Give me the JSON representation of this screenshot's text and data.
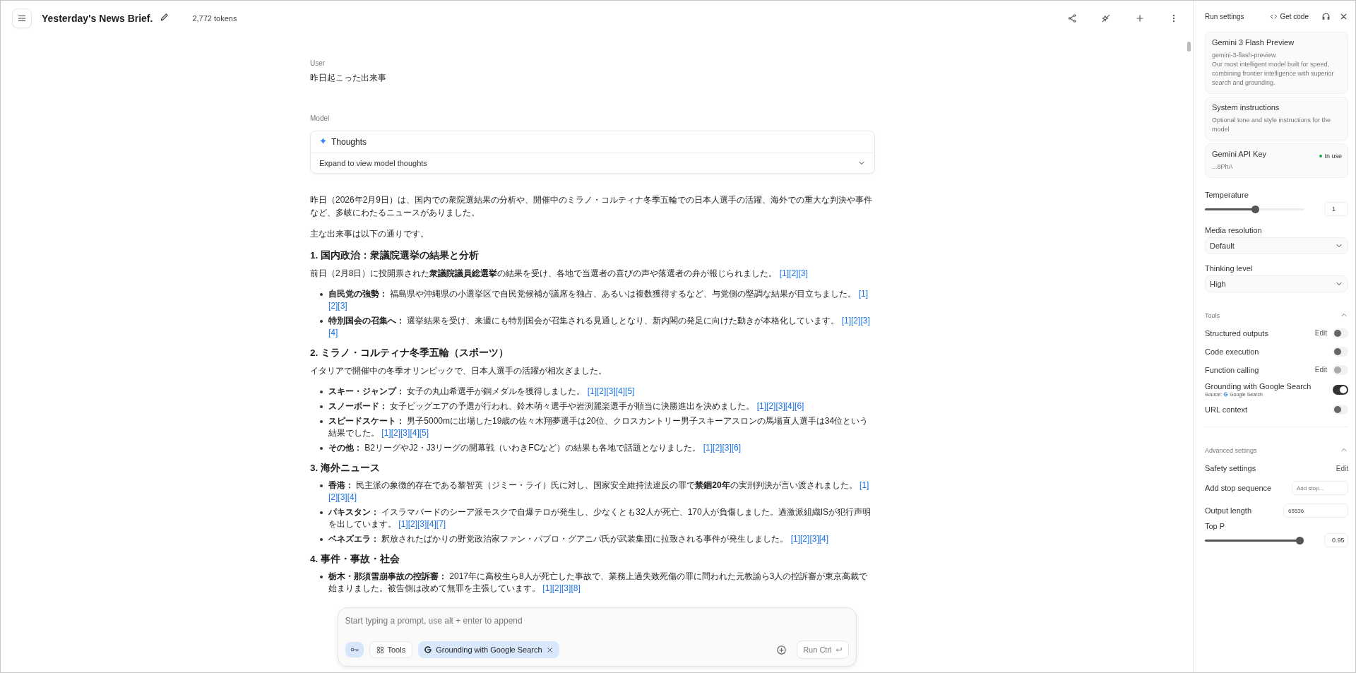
{
  "header": {
    "title": "Yesterday's News Brief.",
    "tokens": "2,772 tokens"
  },
  "conversation": {
    "user_label": "User",
    "user_text": "昨日起こった出来事",
    "model_label": "Model",
    "thoughts": {
      "title": "Thoughts",
      "hint": "Expand to view model thoughts",
      "expanded": false
    }
  },
  "response": [
    {
      "kind": "paragraph",
      "text": "昨日（2026年2月9日）は、国内での衆院選結果の分析や、開催中のミラノ・コルティナ冬季五輪での日本人選手の活躍、海外での重大な判決や事件など、多岐にわたるニュースがありました。"
    },
    {
      "kind": "paragraph",
      "text": "主な出来事は以下の通りです。"
    },
    {
      "kind": "heading",
      "text": "1. 国内政治：衆議院選挙の結果と分析"
    },
    {
      "kind": "paragraph",
      "text": "前日（2月8日）に投開票された**衆議院議員総選挙**の結果を受け、各地で当選者の喜びの声や落選者の弁が報じられました。",
      "cites": [
        "[1]",
        "[2]",
        "[3]"
      ]
    },
    {
      "kind": "bullet",
      "text": "**自民党の強勢：** 福島県や沖縄県の小選挙区で自民党候補が議席を独占、あるいは複数獲得するなど、与党側の堅調な結果が目立ちました。",
      "cites": [
        "[1]",
        "[2]",
        "[3]"
      ]
    },
    {
      "kind": "bullet",
      "text": "**特別国会の召集へ：** 選挙結果を受け、来週にも特別国会が召集される見通しとなり、新内閣の発足に向けた動きが本格化しています。",
      "cites": [
        "[1]",
        "[2]",
        "[3]",
        "[4]"
      ]
    },
    {
      "kind": "heading",
      "text": "2. ミラノ・コルティナ冬季五輪（スポーツ）"
    },
    {
      "kind": "paragraph",
      "text": "イタリアで開催中の冬季オリンピックで、日本人選手の活躍が相次ぎました。"
    },
    {
      "kind": "bullet",
      "text": "**スキー・ジャンプ：** 女子の丸山希選手が銅メダルを獲得しました。",
      "cites": [
        "[1]",
        "[2]",
        "[3]",
        "[4]",
        "[5]"
      ]
    },
    {
      "kind": "bullet",
      "text": "**スノーボード：** 女子ビッグエアの予選が行われ、鈴木萌々選手や岩渕麗楽選手が順当に決勝進出を決めました。",
      "cites": [
        "[1]",
        "[2]",
        "[3]",
        "[4]",
        "[6]"
      ]
    },
    {
      "kind": "bullet",
      "text": "**スピードスケート：** 男子5000mに出場した19歳の佐々木翔夢選手は20位、クロスカントリー男子スキーアスロンの馬場直人選手は34位という結果でした。",
      "cites": [
        "[1]",
        "[2]",
        "[3]",
        "[4]",
        "[5]"
      ]
    },
    {
      "kind": "bullet",
      "text": "**その他：** B2リーグやJ2・J3リーグの開幕戦（いわきFCなど）の結果も各地で話題となりました。",
      "cites": [
        "[1]",
        "[2]",
        "[3]",
        "[6]"
      ]
    },
    {
      "kind": "heading",
      "text": "3. 海外ニュース"
    },
    {
      "kind": "bullet",
      "text": "**香港：** 民主派の象徴的存在である黎智英（ジミー・ライ）氏に対し、国家安全維持法違反の罪で**禁錮20年**の実刑判決が言い渡されました。",
      "cites": [
        "[1]",
        "[2]",
        "[3]",
        "[4]"
      ]
    },
    {
      "kind": "bullet",
      "text": "**パキスタン：** イスラマバードのシーア派モスクで自爆テロが発生し、少なくとも32人が死亡、170人が負傷しました。過激派組織ISが犯行声明を出しています。",
      "cites": [
        "[1]",
        "[2]",
        "[3]",
        "[4]",
        "[7]"
      ]
    },
    {
      "kind": "bullet",
      "text": "**ベネズエラ：** 釈放されたばかりの野党政治家ファン・パブロ・グアニパ氏が武装集団に拉致される事件が発生しました。",
      "cites": [
        "[1]",
        "[2]",
        "[3]",
        "[4]"
      ]
    },
    {
      "kind": "heading",
      "text": "4. 事件・事故・社会"
    },
    {
      "kind": "bullet",
      "text": "**栃木・那須雪崩事故の控訴審：** 2017年に高校生ら8人が死亡した事故で、業務上過失致死傷の罪に問われた元教諭ら3人の控訴審が東京高裁で始まりました。被告側は改めて無罪を主張しています。",
      "cites": [
        "[1]",
        "[2]",
        "[3]",
        "[8]"
      ]
    }
  ],
  "prompt": {
    "placeholder": "Start typing a prompt, use alt + enter to append",
    "tools_label": "Tools",
    "chip": "Grounding with Google Search",
    "run_label": "Run Ctrl"
  },
  "settings": {
    "title": "Run settings",
    "get_code": "Get code",
    "model": {
      "name": "Gemini 3 Flash Preview",
      "id": "gemini-3-flash-preview",
      "description": "Our most intelligent model built for speed, combining frontier intelligence with superior search and grounding."
    },
    "system": {
      "title": "System instructions",
      "hint": "Optional tone and style instructions for the model"
    },
    "api_key": {
      "title": "Gemini API Key",
      "status": "In use",
      "value": "...8PhA"
    },
    "temperature": {
      "label": "Temperature",
      "level": 0.5,
      "value": "1"
    },
    "media_resolution": {
      "label": "Media resolution",
      "value": "Default"
    },
    "thinking_level": {
      "label": "Thinking level",
      "value": "High"
    },
    "tools": {
      "label": "Tools",
      "expanded": true,
      "items": [
        {
          "label": "Structured outputs",
          "edit": "Edit",
          "on": false,
          "disabled": false
        },
        {
          "label": "Code execution",
          "on": false,
          "disabled": false
        },
        {
          "label": "Function calling",
          "edit": "Edit",
          "on": false,
          "disabled": true
        },
        {
          "label": "Grounding with Google Search",
          "source": "Source:",
          "source_name": "Google Search",
          "on": true,
          "disabled": false
        },
        {
          "label": "URL context",
          "on": false,
          "disabled": false
        }
      ]
    },
    "advanced": {
      "label": "Advanced settings",
      "expanded": true,
      "safety": {
        "label": "Safety settings",
        "action": "Edit"
      },
      "stop": {
        "label": "Add stop sequence",
        "placeholder": "Add stop..."
      },
      "output_length": {
        "label": "Output length",
        "value": "65536"
      },
      "top_p": {
        "label": "Top P",
        "level": 0.95,
        "value": "0.95"
      }
    }
  }
}
